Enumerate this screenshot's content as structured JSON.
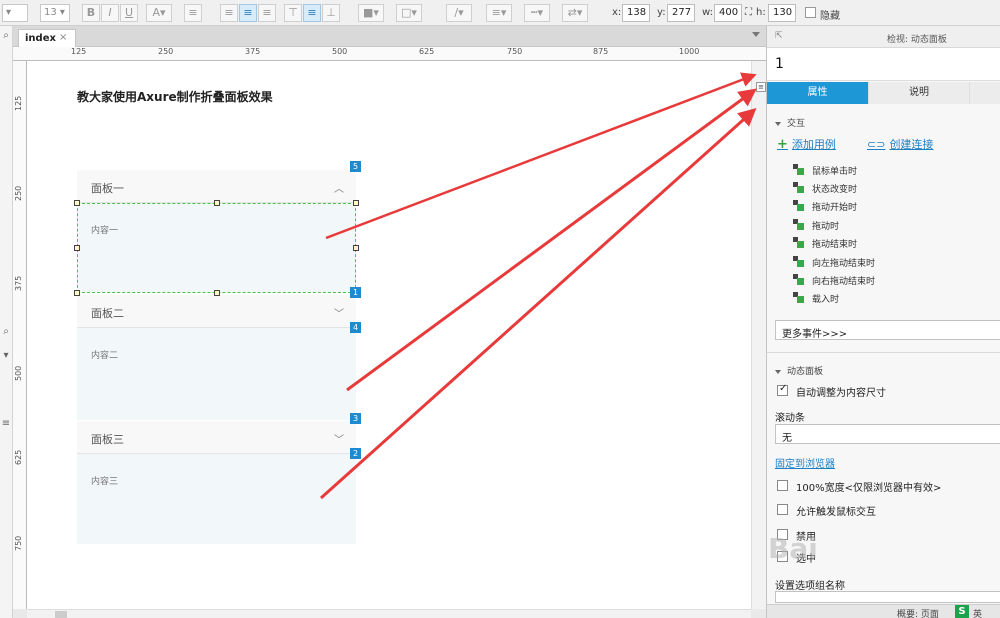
{
  "toolbar": {
    "font_size": "13",
    "x_label": "x:",
    "x_value": "138",
    "y_label": "y:",
    "y_value": "277",
    "w_label": "w:",
    "w_value": "400",
    "h_label": "h:",
    "h_value": "130",
    "hidden_label": "隐藏"
  },
  "tab": {
    "label": "index",
    "close": "×"
  },
  "ruler": {
    "h_ticks": [
      "125",
      "250",
      "375",
      "500",
      "625",
      "750",
      "875",
      "1000"
    ],
    "v_ticks": [
      "125",
      "250",
      "375",
      "500",
      "625",
      "750"
    ]
  },
  "canvas": {
    "title": "教大家使用Axure制作折叠面板效果",
    "panels": [
      {
        "title": "面板一",
        "content": "内容一",
        "chevron": "︿"
      },
      {
        "title": "面板二",
        "content": "内容二",
        "chevron": "﹀"
      },
      {
        "title": "面板三",
        "content": "内容三",
        "chevron": "﹀"
      }
    ],
    "badges": [
      "5",
      "1",
      "4",
      "3",
      "2"
    ],
    "mini_menu": "≡"
  },
  "right_panel": {
    "header_title": "检视: 动态面板",
    "name_value": "1",
    "tabs": [
      "属性",
      "说明"
    ],
    "interaction_section": "交互",
    "add_case": "添加用例",
    "create_link": "创建连接",
    "events": [
      "鼠标单击时",
      "状态改变时",
      "拖动开始时",
      "拖动时",
      "拖动结束时",
      "向左拖动结束时",
      "向右拖动结束时",
      "载入时"
    ],
    "more_events": "更多事件>>>",
    "dynamic_panel_section": "动态面板",
    "auto_fit": "自动调整为内容尺寸",
    "scrollbar_label": "滚动条",
    "scrollbar_value": "无",
    "pin_to_browser": "固定到浏览器",
    "options": [
      "100%宽度<仅限浏览器中有效>",
      "允许触发鼠标交互",
      "禁用",
      "选中"
    ],
    "selection_group": "设置选项组名称",
    "footer_left": "概要: 页面",
    "footer_right": "英"
  },
  "colors": {
    "accent": "#1e97d7",
    "badge": "#1e8bd0",
    "arrow": "#e83a3a",
    "selection": "#4cc24c"
  },
  "watermark": "Bai"
}
